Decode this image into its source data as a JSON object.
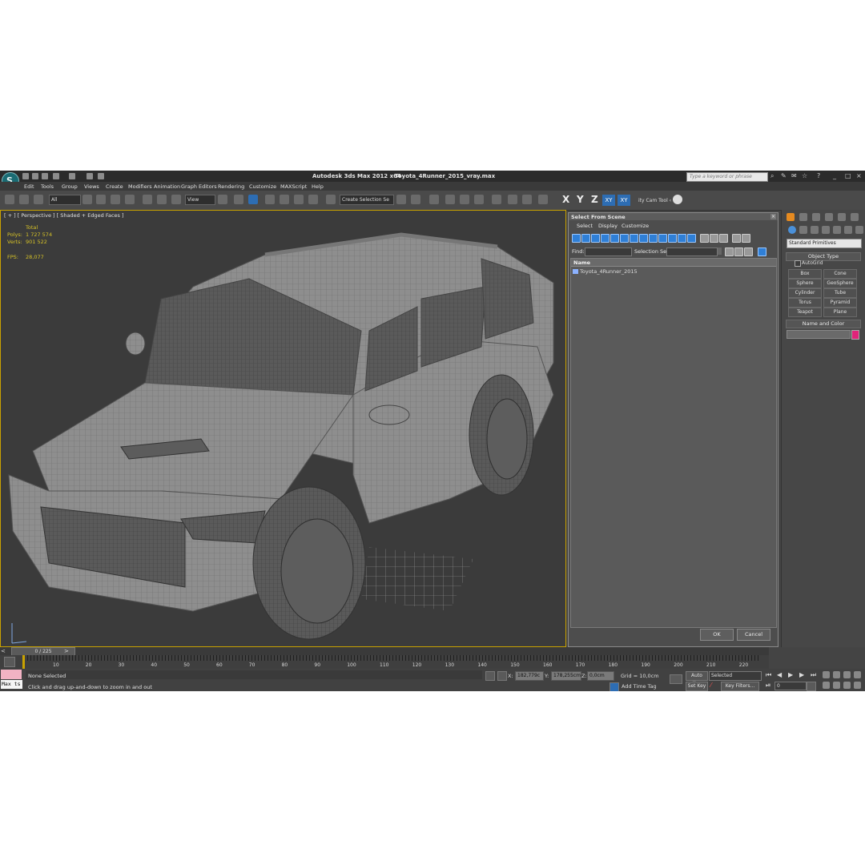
{
  "titlebar": {
    "app_title": "Autodesk 3ds Max  2012 x64",
    "file_name": "Toyota_4Runner_2015_vray.max",
    "search_placeholder": "Type a keyword or phrase"
  },
  "menu": [
    "Edit",
    "Tools",
    "Group",
    "Views",
    "Create",
    "Modifiers",
    "Animation",
    "Graph Editors",
    "Rendering",
    "Customize",
    "MAXScript",
    "Help"
  ],
  "toolbar": {
    "selection_filter": "All",
    "ref_coord": "View",
    "selection_set": "Create Selection Se",
    "axes": [
      "X",
      "Y",
      "Z"
    ],
    "xy_buttons": [
      "XY",
      "XY"
    ],
    "city_tool": "ity Cam Tool ‹"
  },
  "viewport": {
    "label": "[ + ] [ Perspective ] [ Shaded + Edged Faces ]",
    "stats_header": "Total",
    "polys_label": "Polys:",
    "polys_value": "1 727 574",
    "verts_label": "Verts:",
    "verts_value": "901 522",
    "fps_label": "FPS:",
    "fps_value": "28,077",
    "colors": {
      "border": "#c9a200",
      "stats": "#d6c227",
      "mesh": "#8e8e8e"
    }
  },
  "dialog": {
    "title": "Select From Scene",
    "menus": [
      "Select",
      "Display",
      "Customize"
    ],
    "find_label": "Find:",
    "selection_set_label": "Selection Set:",
    "column_header": "Name",
    "items": [
      "Toyota_4Runner_2015"
    ],
    "ok_label": "OK",
    "cancel_label": "Cancel"
  },
  "command_panel": {
    "category": "Standard Primitives",
    "object_type_header": "Object Type",
    "autogrid_label": "AutoGrid",
    "primitives": [
      "Box",
      "Cone",
      "Sphere",
      "GeoSphere",
      "Cylinder",
      "Tube",
      "Torus",
      "Pyramid",
      "Teapot",
      "Plane"
    ],
    "name_color_header": "Name and Color",
    "swatch_color": "#e0247a"
  },
  "timeline": {
    "frame_counter": "0 / 225",
    "ticks": [
      "10",
      "20",
      "30",
      "40",
      "50",
      "60",
      "70",
      "80",
      "90",
      "100",
      "110",
      "120",
      "130",
      "140",
      "150",
      "160",
      "170",
      "180",
      "190",
      "200",
      "210",
      "220"
    ]
  },
  "status": {
    "maxscript_label": "Max ts",
    "selection_text": "None Selected",
    "prompt_text": "Click and drag up-and-down to zoom in and out",
    "x_label": "X:",
    "x_value": "182,779c",
    "y_label": "Y:",
    "y_value": "178,255cm",
    "z_label": "Z:",
    "z_value": "0,0cm",
    "grid_text": "Grid = 10,0cm",
    "add_time_tag": "Add Time Tag",
    "auto_key": "Auto Key",
    "set_key": "Set Key",
    "key_mode": "Selected",
    "key_filters": "Key Filters...",
    "current_frame": "0"
  }
}
